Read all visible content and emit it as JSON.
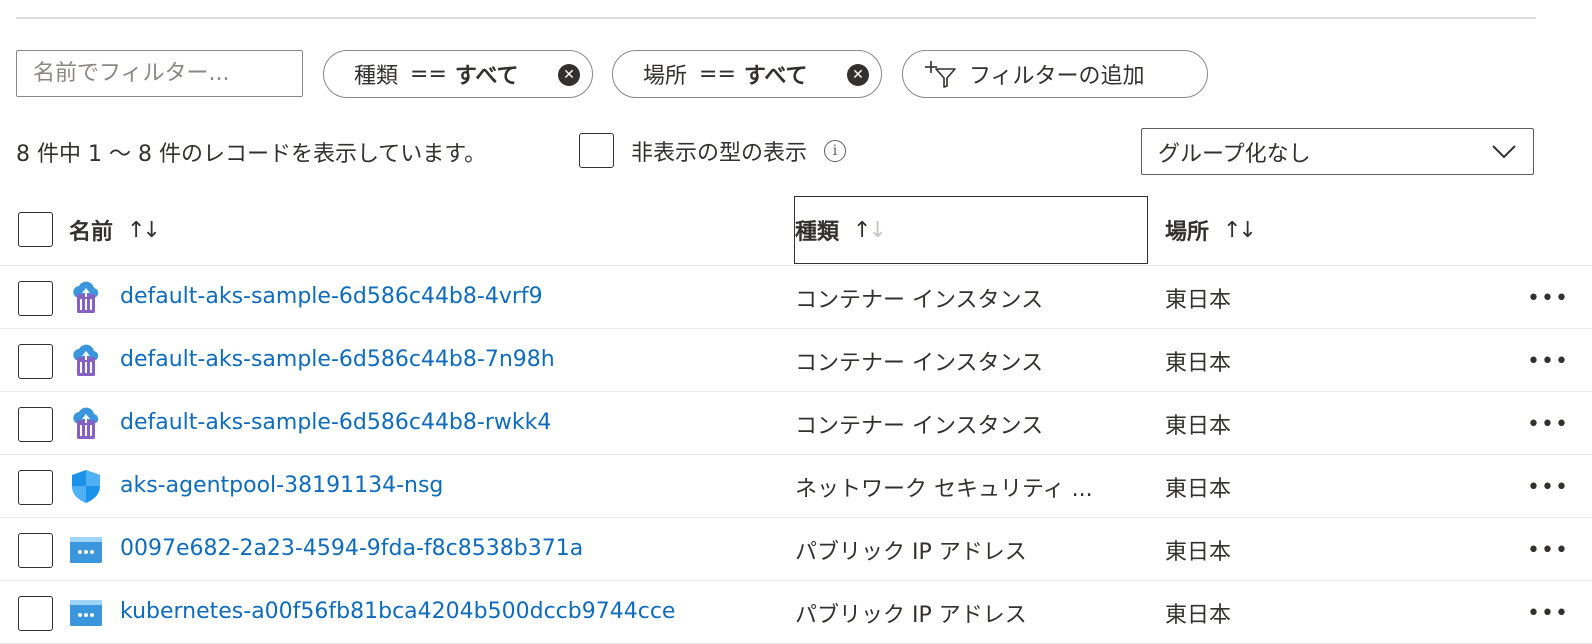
{
  "filters": {
    "name_placeholder": "名前でフィルター...",
    "type_pill": {
      "label": "種類",
      "op": "==",
      "value": "すべて"
    },
    "location_pill": {
      "label": "場所",
      "op": "==",
      "value": "すべて"
    },
    "add_filter_label": "フィルターの追加"
  },
  "info": {
    "record_count": "8 件中 1 ～ 8 件のレコードを表示しています。",
    "show_hidden_label": "非表示の型の表示",
    "info_glyph": "i",
    "grouping_value": "グループ化なし"
  },
  "table": {
    "headers": {
      "name": "名前",
      "type": "種類",
      "location": "場所"
    },
    "sort_glyph_up": "↑",
    "sort_glyph_down": "↓",
    "more_glyph": "•••",
    "rows": [
      {
        "icon": "container-instance-icon",
        "name": "default-aks-sample-6d586c44b8-4vrf9",
        "type": "コンテナー インスタンス",
        "location": "東日本"
      },
      {
        "icon": "container-instance-icon",
        "name": "default-aks-sample-6d586c44b8-7n98h",
        "type": "コンテナー インスタンス",
        "location": "東日本"
      },
      {
        "icon": "container-instance-icon",
        "name": "default-aks-sample-6d586c44b8-rwkk4",
        "type": "コンテナー インスタンス",
        "location": "東日本"
      },
      {
        "icon": "network-security-group-icon",
        "name": "aks-agentpool-38191134-nsg",
        "type": "ネットワーク セキュリティ ...",
        "location": "東日本"
      },
      {
        "icon": "public-ip-icon",
        "name": "0097e682-2a23-4594-9fda-f8c8538b371a",
        "type": "パブリック IP アドレス",
        "location": "東日本"
      },
      {
        "icon": "public-ip-icon",
        "name": "kubernetes-a00f56fb81bca4204b500dccb9744cce",
        "type": "パブリック IP アドレス",
        "location": "東日本"
      }
    ]
  },
  "colors": {
    "link": "#0f6cbd",
    "text": "#323130",
    "border": "#8a8886",
    "divider": "#edebe9"
  }
}
